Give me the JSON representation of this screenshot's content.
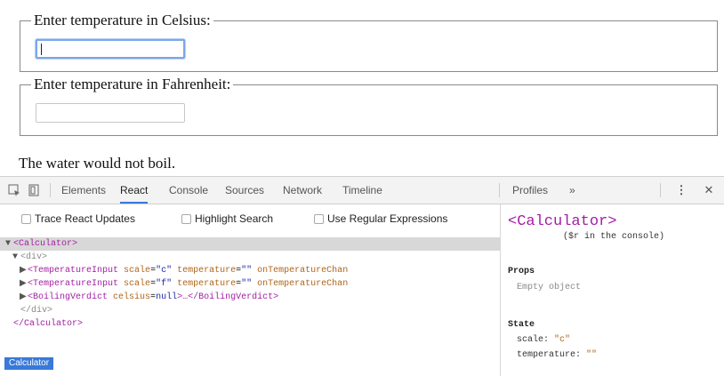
{
  "app": {
    "celsius_legend": "Enter temperature in Celsius:",
    "fahrenheit_legend": "Enter temperature in Fahrenheit:",
    "celsius_value": "",
    "fahrenheit_value": "",
    "verdict": "The water would not boil."
  },
  "devtools": {
    "tabs": [
      "Elements",
      "React",
      "Console",
      "Sources",
      "Network",
      "Timeline",
      "Profiles",
      "»"
    ],
    "active_tab": "React",
    "icons": [
      "inspect-icon",
      "device-icon",
      "more-icon",
      "close-icon"
    ],
    "options": [
      "Trace React Updates",
      "Highlight Search",
      "Use Regular Expressions"
    ],
    "tree": {
      "root_open": "<Calculator>",
      "div_open": "<div>",
      "row1": {
        "tag": "<TemperatureInput",
        "a1": "scale",
        "v1": "\"c\"",
        "a2": "temperature",
        "v2": "\"\"",
        "a3": "onTemperatureChan"
      },
      "row2": {
        "tag": "<TemperatureInput",
        "a1": "scale",
        "v1": "\"f\"",
        "a2": "temperature",
        "v2": "\"\"",
        "a3": "onTemperatureChan"
      },
      "row3": {
        "tag": "<BoilingVerdict",
        "a1": "celsius",
        "v1": "null",
        "rest": ">…</BoilingVerdict>"
      },
      "div_close": "</div>",
      "root_close": "</Calculator>"
    },
    "breadcrumb": "Calculator",
    "side": {
      "component": "<Calculator>",
      "console_hint": "($r in the console)",
      "props_heading": "Props",
      "props_value": "Empty object",
      "state_heading": "State",
      "state": [
        {
          "key": "scale:",
          "value": "\"c\""
        },
        {
          "key": "temperature:",
          "value": "\"\""
        }
      ]
    }
  }
}
